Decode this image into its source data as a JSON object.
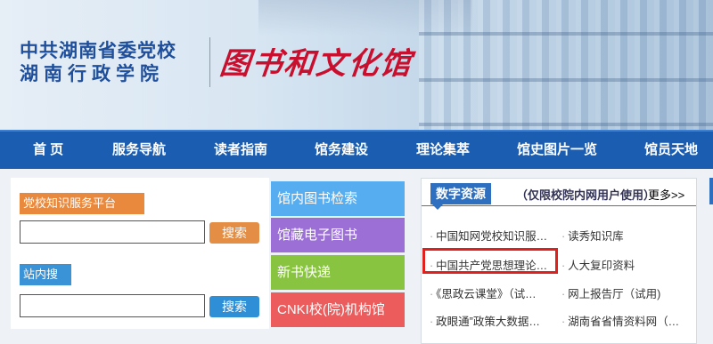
{
  "banner": {
    "school_line1": "中共湖南省委党校",
    "school_line2": "湖南行政学院",
    "library_name": "图书和文化馆"
  },
  "nav": {
    "items": [
      "首 页",
      "服务导航",
      "读者指南",
      "馆务建设",
      "理论集萃",
      "馆史图片一览",
      "馆员天地"
    ]
  },
  "left_panel": {
    "knowledge_platform_label": "党校知识服务平台",
    "search_button_1": "搜索",
    "site_search_label": "站内搜索",
    "search_button_2": "搜索",
    "input1_value": "",
    "input2_value": ""
  },
  "tiles": [
    {
      "label": "馆内图书检索",
      "color": "#56aef0"
    },
    {
      "label": "馆藏电子图书",
      "color": "#9b6fd6"
    },
    {
      "label": "新书快递",
      "color": "#88c43f"
    },
    {
      "label": "CNKI校(院)机构馆",
      "color": "#ec5c5c"
    }
  ],
  "digital": {
    "title": "数字资源",
    "note": "（仅限校院内网用户使用）",
    "more": "更多>>",
    "items": [
      {
        "left": "中国知网党校知识服…",
        "right": "读秀知识库"
      },
      {
        "left": "中国共产党思想理论…",
        "right": "人大复印资料"
      },
      {
        "left": "《思政云课堂》（试…",
        "right": "网上报告厅（试用)"
      },
      {
        "left": "政眼通”政策大数据…",
        "right": "湖南省省情资料网（…"
      }
    ],
    "bullet": "·"
  },
  "colors": {
    "nav_bg": "#1a5db1",
    "highlight_border": "#e0201c",
    "orange": "#e8893e",
    "blue": "#3a93d6"
  }
}
